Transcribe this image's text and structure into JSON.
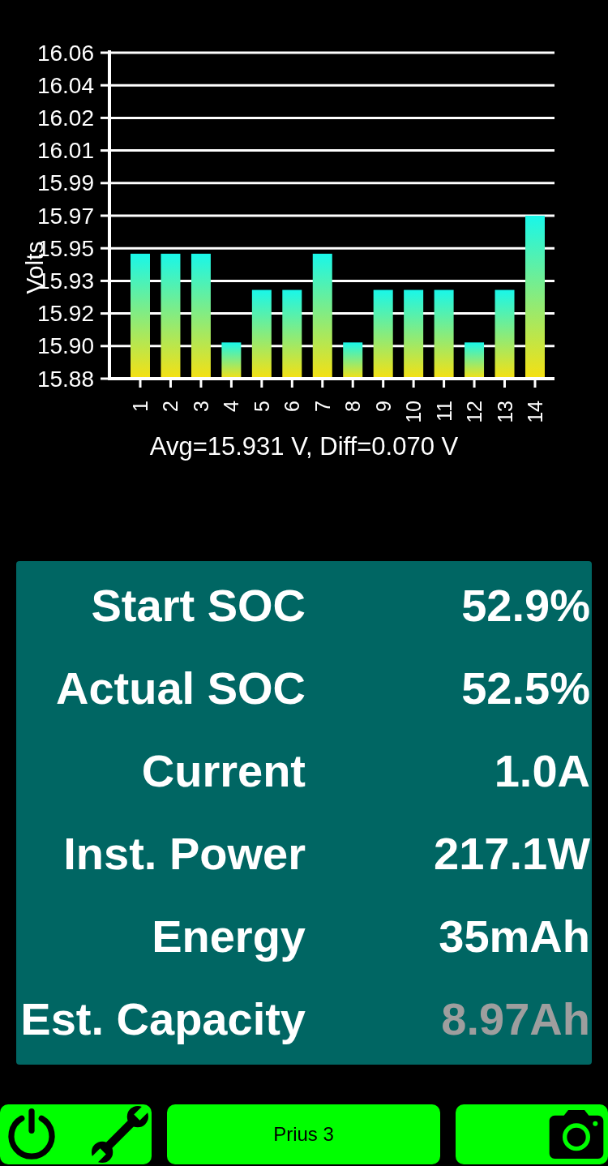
{
  "chart": {
    "chart_data": {
      "type": "bar",
      "grid": true,
      "xlabel": "Avg=15.931 V, Diff=0.070 V",
      "ylabel": "Volts",
      "categories": [
        "1",
        "2",
        "3",
        "4",
        "5",
        "6",
        "7",
        "8",
        "9",
        "10",
        "11",
        "12",
        "13",
        "14"
      ],
      "values": [
        15.949,
        15.949,
        15.949,
        15.9,
        15.929,
        15.929,
        15.949,
        15.9,
        15.929,
        15.929,
        15.929,
        15.9,
        15.929,
        15.97
      ],
      "ylim": [
        15.88,
        16.06
      ],
      "yticks": [
        {
          "value": 15.88,
          "label": "15.88"
        },
        {
          "value": 15.898,
          "label": "15.90"
        },
        {
          "value": 15.916,
          "label": "15.92"
        },
        {
          "value": 15.934,
          "label": "15.93"
        },
        {
          "value": 15.952,
          "label": "15.95"
        },
        {
          "value": 15.97,
          "label": "15.97"
        },
        {
          "value": 15.988,
          "label": "15.99"
        },
        {
          "value": 16.006,
          "label": "16.01"
        },
        {
          "value": 16.024,
          "label": "16.02"
        },
        {
          "value": 16.042,
          "label": "16.04"
        },
        {
          "value": 16.06,
          "label": "16.06"
        }
      ]
    }
  },
  "readings": [
    {
      "label": "Start SOC",
      "value": "52.9%",
      "greyed": false
    },
    {
      "label": "Actual SOC",
      "value": "52.5%",
      "greyed": false
    },
    {
      "label": "Current",
      "value": "1.0A",
      "greyed": false
    },
    {
      "label": "Inst. Power",
      "value": "217.1W",
      "greyed": false
    },
    {
      "label": "Energy",
      "value": "35mAh",
      "greyed": false
    },
    {
      "label": "Est. Capacity",
      "value": "8.97Ah",
      "greyed": true
    }
  ],
  "bottom_bar": {
    "center_button": "Prius 3"
  }
}
